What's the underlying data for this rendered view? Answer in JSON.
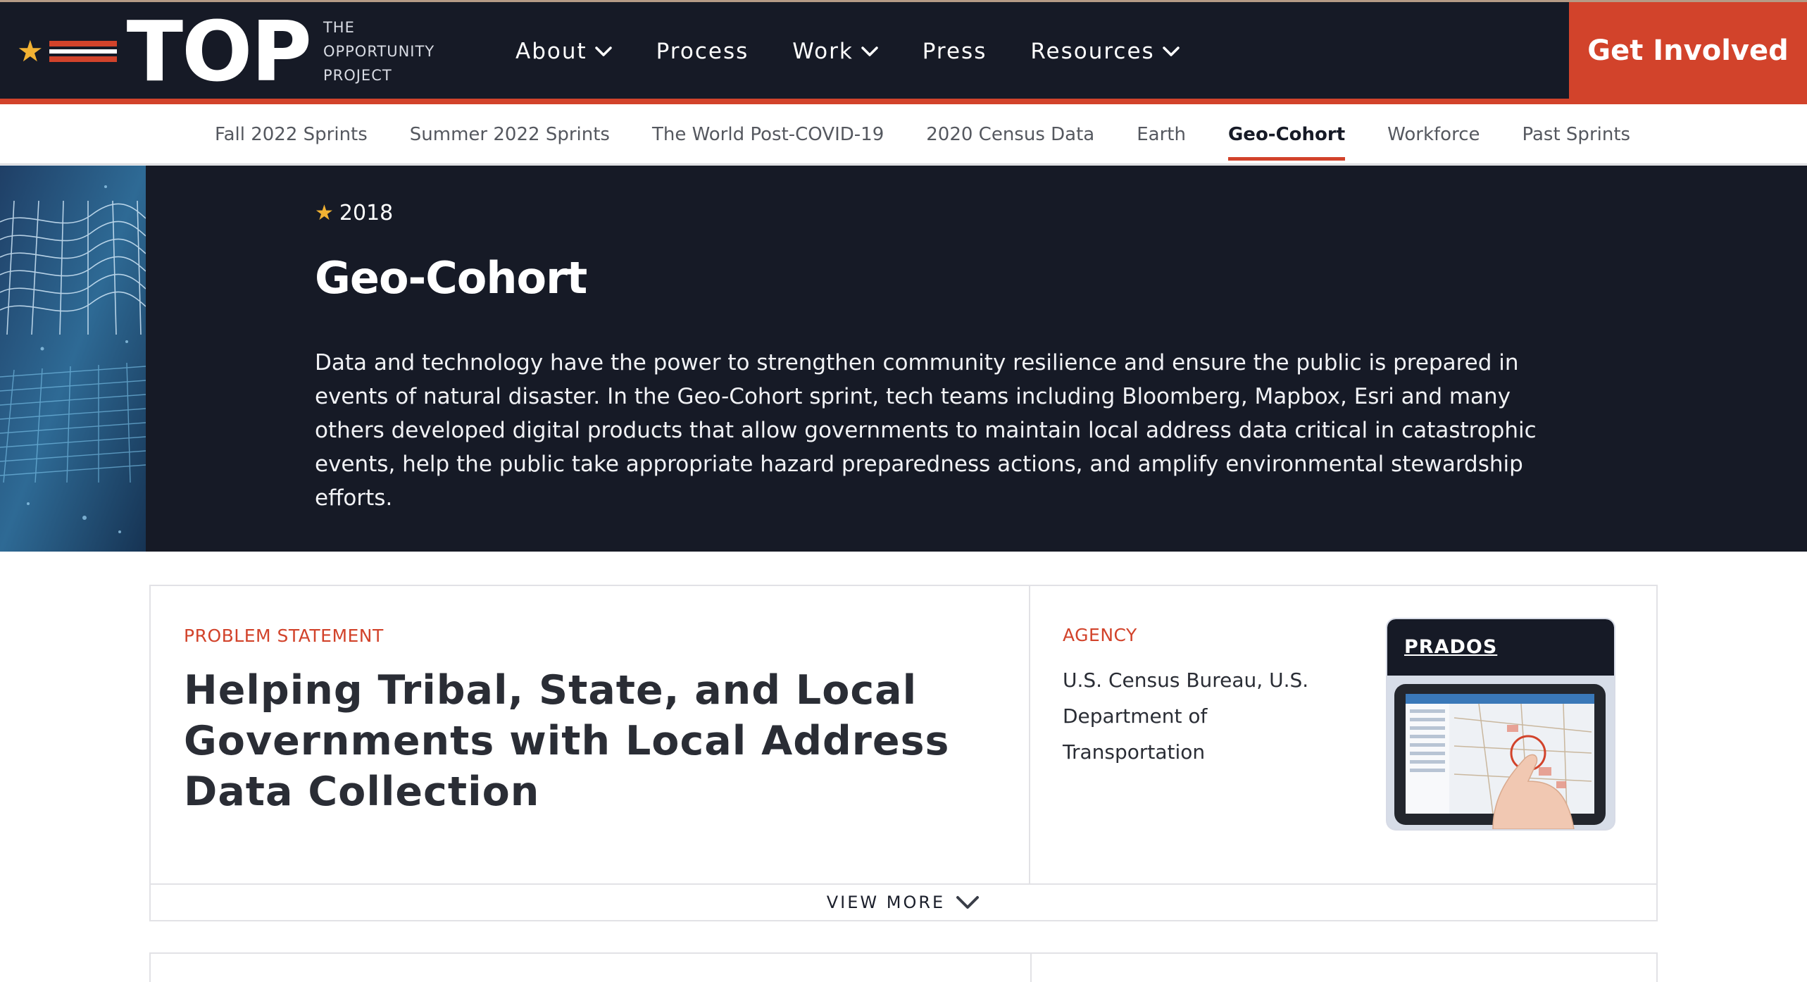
{
  "header": {
    "logo": {
      "word": "TOP",
      "sub_lines": [
        "THE",
        "OPPORTUNITY",
        "PROJECT"
      ]
    },
    "nav": [
      {
        "label": "About",
        "has_dropdown": true
      },
      {
        "label": "Process",
        "has_dropdown": false
      },
      {
        "label": "Work",
        "has_dropdown": true
      },
      {
        "label": "Press",
        "has_dropdown": false
      },
      {
        "label": "Resources",
        "has_dropdown": true
      }
    ],
    "cta_label": "Get Involved"
  },
  "subnav": {
    "items": [
      {
        "label": "Fall 2022 Sprints",
        "active": false
      },
      {
        "label": "Summer 2022 Sprints",
        "active": false
      },
      {
        "label": "The World Post-COVID-19",
        "active": false
      },
      {
        "label": "2020 Census Data",
        "active": false
      },
      {
        "label": "Earth",
        "active": false
      },
      {
        "label": "Geo-Cohort",
        "active": true
      },
      {
        "label": "Workforce",
        "active": false
      },
      {
        "label": "Past Sprints",
        "active": false
      }
    ]
  },
  "hero": {
    "year": "2018",
    "title": "Geo-Cohort",
    "description": "Data and technology have the power to strengthen community resilience and ensure the public is prepared in events of natural disaster. In the Geo-Cohort sprint, tech teams including Bloomberg, Mapbox, Esri and many others developed digital products that allow governments to maintain local address data critical in catastrophic events, help the public take appropriate hazard preparedness actions, and amplify environmental stewardship efforts."
  },
  "card": {
    "problem_label": "PROBLEM STATEMENT",
    "problem_title": "Helping Tribal, State, and Local Governments with Local Address Data Collection",
    "agency_label": "AGENCY",
    "agency_text": "U.S. Census Bureau, U.S. Department of Transportation",
    "product_name": "PRADOS",
    "view_more_label": "VIEW MORE"
  },
  "colors": {
    "navy": "#161a26",
    "accent_red": "#d2432b",
    "star_gold": "#f2b233"
  }
}
